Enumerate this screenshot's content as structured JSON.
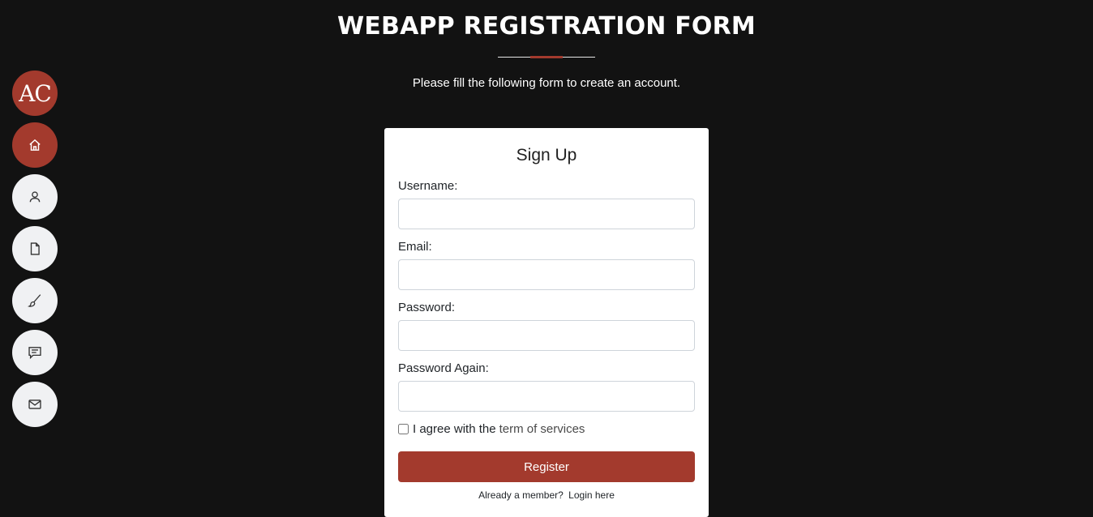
{
  "header": {
    "title": "WEBAPP REGISTRATION FORM",
    "subtitle": "Please fill the following form to create an account."
  },
  "sidebar": {
    "logo_text": "AC",
    "items": [
      {
        "icon": "home-icon",
        "active": true
      },
      {
        "icon": "user-icon",
        "active": false
      },
      {
        "icon": "file-icon",
        "active": false
      },
      {
        "icon": "brush-icon",
        "active": false
      },
      {
        "icon": "chat-icon",
        "active": false
      },
      {
        "icon": "mail-icon",
        "active": false
      }
    ]
  },
  "form": {
    "title": "Sign Up",
    "username_label": "Username:",
    "username_value": "",
    "email_label": "Email:",
    "email_value": "",
    "password_label": "Password:",
    "password_value": "",
    "password_again_label": "Password Again:",
    "password_again_value": "",
    "terms_text": "I agree with the",
    "terms_link": "term of services",
    "terms_checked": false,
    "register_label": "Register",
    "login_prompt": "Already a member?",
    "login_link": "Login here"
  },
  "colors": {
    "accent": "#a33a2d",
    "background": "#121212"
  }
}
